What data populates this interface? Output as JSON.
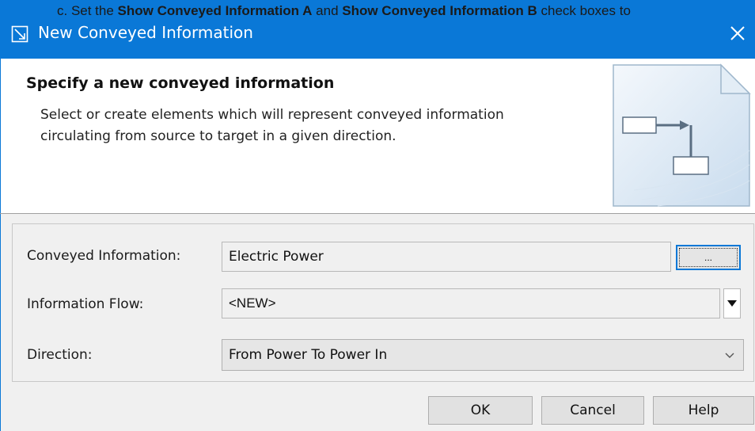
{
  "background_caption": {
    "prefix": "c.  Set the ",
    "bold1": "Show Conveyed Information A",
    "mid": " and ",
    "bold2": "Show Conveyed Information B",
    "suffix": "  check boxes to"
  },
  "window": {
    "title": "New Conveyed Information",
    "icon": "dialog-icon",
    "close_icon": "close-icon",
    "accent_color": "#0a78d7"
  },
  "header": {
    "title": "Specify a new conveyed information",
    "description": "Select or create elements which will represent conveyed information circulating from source to target in a given direction.",
    "image": "document-diagram-icon"
  },
  "form": {
    "conveyed_information": {
      "label": "Conveyed Information:",
      "value": "Electric Power",
      "browse_label": "..."
    },
    "information_flow": {
      "label": "Information Flow:",
      "value": "<NEW>"
    },
    "direction": {
      "label": "Direction:",
      "value": "From Power To Power In"
    }
  },
  "buttons": {
    "ok": "OK",
    "cancel": "Cancel",
    "help": "Help"
  }
}
